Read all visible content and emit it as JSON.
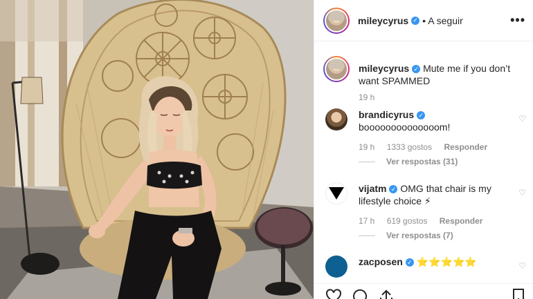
{
  "post": {
    "image_description_icon": "photo-of-woman-in-wicker-chair"
  },
  "header": {
    "username": "mileycyrus",
    "verified_icon": "check-icon",
    "follow_label": "• A seguir",
    "more_label": "•••"
  },
  "caption": {
    "username": "mileycyrus",
    "text": "Mute me if you don’t want SPAMMED",
    "time": "19 h"
  },
  "comments": [
    {
      "username": "brandicyrus",
      "text": "boooooooooooooom!",
      "time": "19 h",
      "likes": "1333 gostos",
      "reply": "Responder",
      "view_replies": "Ver respostas (31)"
    },
    {
      "username": "vijatm",
      "text": "OMG that chair is my lifestyle choice ⚡",
      "time": "17 h",
      "likes": "619 gostos",
      "reply": "Responder",
      "view_replies": "Ver respostas (7)"
    },
    {
      "username": "zacposen",
      "text": "⭐⭐⭐⭐⭐"
    }
  ],
  "colors": {
    "verified": "#3897f0",
    "muted_text": "#8e8e8e",
    "primary_text": "#262626",
    "divider": "#efefef"
  }
}
